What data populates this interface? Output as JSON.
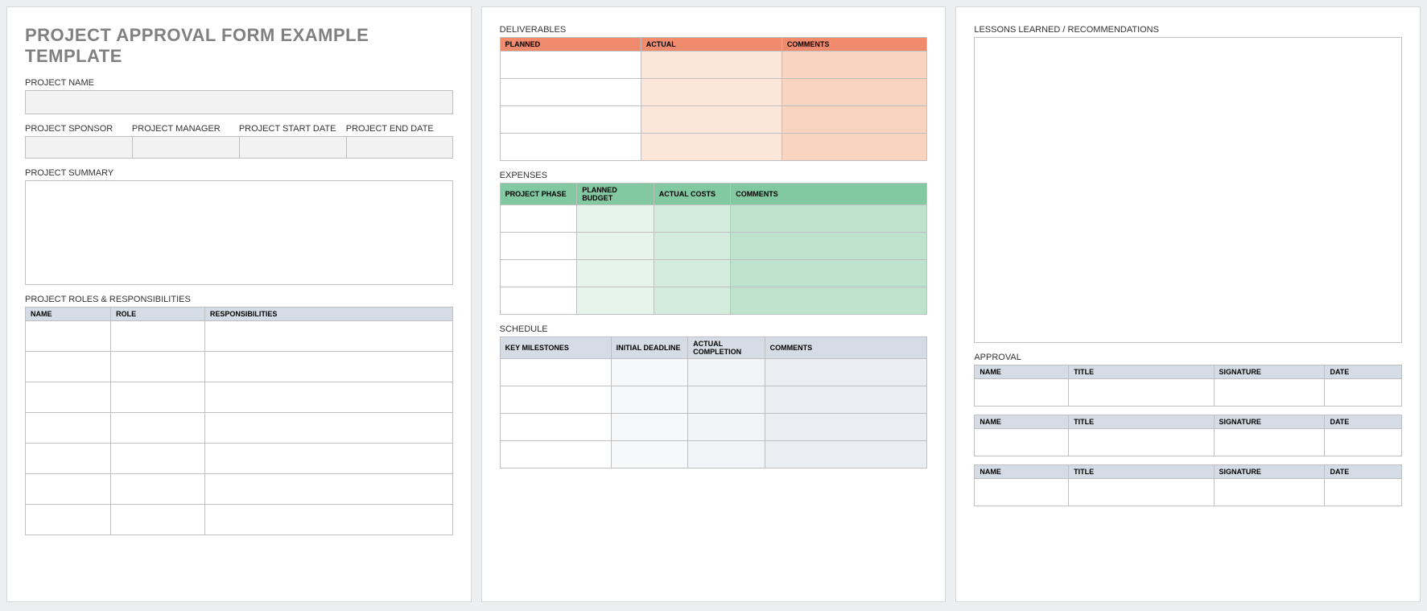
{
  "page1": {
    "title": "PROJECT APPROVAL FORM EXAMPLE TEMPLATE",
    "project_name_label": "PROJECT NAME",
    "sponsor_label": "PROJECT SPONSOR",
    "manager_label": "PROJECT MANAGER",
    "start_label": "PROJECT START DATE",
    "end_label": "PROJECT END DATE",
    "summary_label": "PROJECT SUMMARY",
    "roles_label": "PROJECT ROLES & RESPONSIBILITIES",
    "roles_headers": {
      "name": "NAME",
      "role": "ROLE",
      "resp": "RESPONSIBILITIES"
    }
  },
  "page2": {
    "deliverables_label": "DELIVERABLES",
    "deliv_headers": {
      "planned": "PLANNED",
      "actual": "ACTUAL",
      "comments": "COMMENTS"
    },
    "expenses_label": "EXPENSES",
    "exp_headers": {
      "phase": "PROJECT PHASE",
      "planned": "PLANNED BUDGET",
      "actual": "ACTUAL COSTS",
      "comments": "COMMENTS"
    },
    "schedule_label": "SCHEDULE",
    "sched_headers": {
      "milestones": "KEY MILESTONES",
      "initial": "INITIAL DEADLINE",
      "actual": "ACTUAL COMPLETION",
      "comments": "COMMENTS"
    }
  },
  "page3": {
    "lessons_label": "LESSONS LEARNED / RECOMMENDATIONS",
    "approval_label": "APPROVAL",
    "appr_headers": {
      "name": "NAME",
      "title": "TITLE",
      "signature": "SIGNATURE",
      "date": "DATE"
    }
  }
}
